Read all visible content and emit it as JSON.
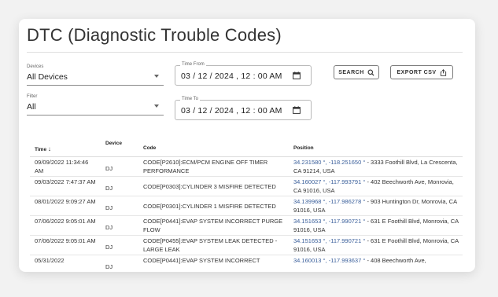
{
  "page": {
    "title": "DTC (Diagnostic Trouble Codes)"
  },
  "filters": {
    "devices": {
      "label": "Devices",
      "value": "All Devices"
    },
    "filter": {
      "label": "Filter",
      "value": "All"
    },
    "time_from": {
      "label": "Time From",
      "value": "03 / 12 / 2024 , 12 : 00  AM"
    },
    "time_to": {
      "label": "Time To",
      "value": "03 / 12 / 2024 , 12 : 00  AM"
    }
  },
  "buttons": {
    "search": "SEARCH",
    "export": "EXPORT CSV"
  },
  "table": {
    "headers": {
      "time": "Time",
      "time_sort": "↓",
      "device": "Device",
      "code": "Code",
      "position": "Position"
    },
    "rows": [
      {
        "time": "09/09/2022 11:34:46 AM",
        "device": "DJ",
        "code": "CODE[P2610]:ECM/PCM ENGINE OFF TIMER PERFORMANCE",
        "coords": "34.231580 °, -118.251650 °",
        "address": " - 3333 Foothill Blvd, La Crescenta, CA 91214, USA"
      },
      {
        "time": "09/03/2022 7:47:37 AM",
        "device": "DJ",
        "code": "CODE[P0303]:CYLINDER 3 MISFIRE DETECTED",
        "coords": "34.160027 °, -117.993791 °",
        "address": " - 402 Beechworth Ave, Monrovia, CA 91016, USA"
      },
      {
        "time": "08/01/2022 9:09:27 AM",
        "device": "DJ",
        "code": "CODE[P0301]:CYLINDER 1 MISFIRE DETECTED",
        "coords": "34.139968 °, -117.986278 °",
        "address": " - 903 Huntington Dr, Monrovia, CA 91016, USA"
      },
      {
        "time": "07/06/2022 9:05:01 AM",
        "device": "DJ",
        "code": "CODE[P0441]:EVAP SYSTEM INCORRECT PURGE FLOW",
        "coords": "34.151653 °, -117.990721 °",
        "address": " - 631 E Foothill Blvd, Monrovia, CA 91016, USA"
      },
      {
        "time": "07/06/2022 9:05:01 AM",
        "device": "DJ",
        "code": "CODE[P0455]:EVAP SYSTEM LEAK DETECTED - LARGE LEAK",
        "coords": "34.151653 °, -117.990721 °",
        "address": " - 631 E Foothill Blvd, Monrovia, CA 91016, USA"
      },
      {
        "time": "05/31/2022",
        "device": "DJ",
        "code": "CODE[P0441]:EVAP SYSTEM INCORRECT",
        "coords": "34.160013 °, -117.993637 °",
        "address": " - 408 Beechworth Ave,"
      }
    ]
  },
  "colors": {
    "link": "#3a5f9b",
    "border": "#b8b8b8"
  }
}
